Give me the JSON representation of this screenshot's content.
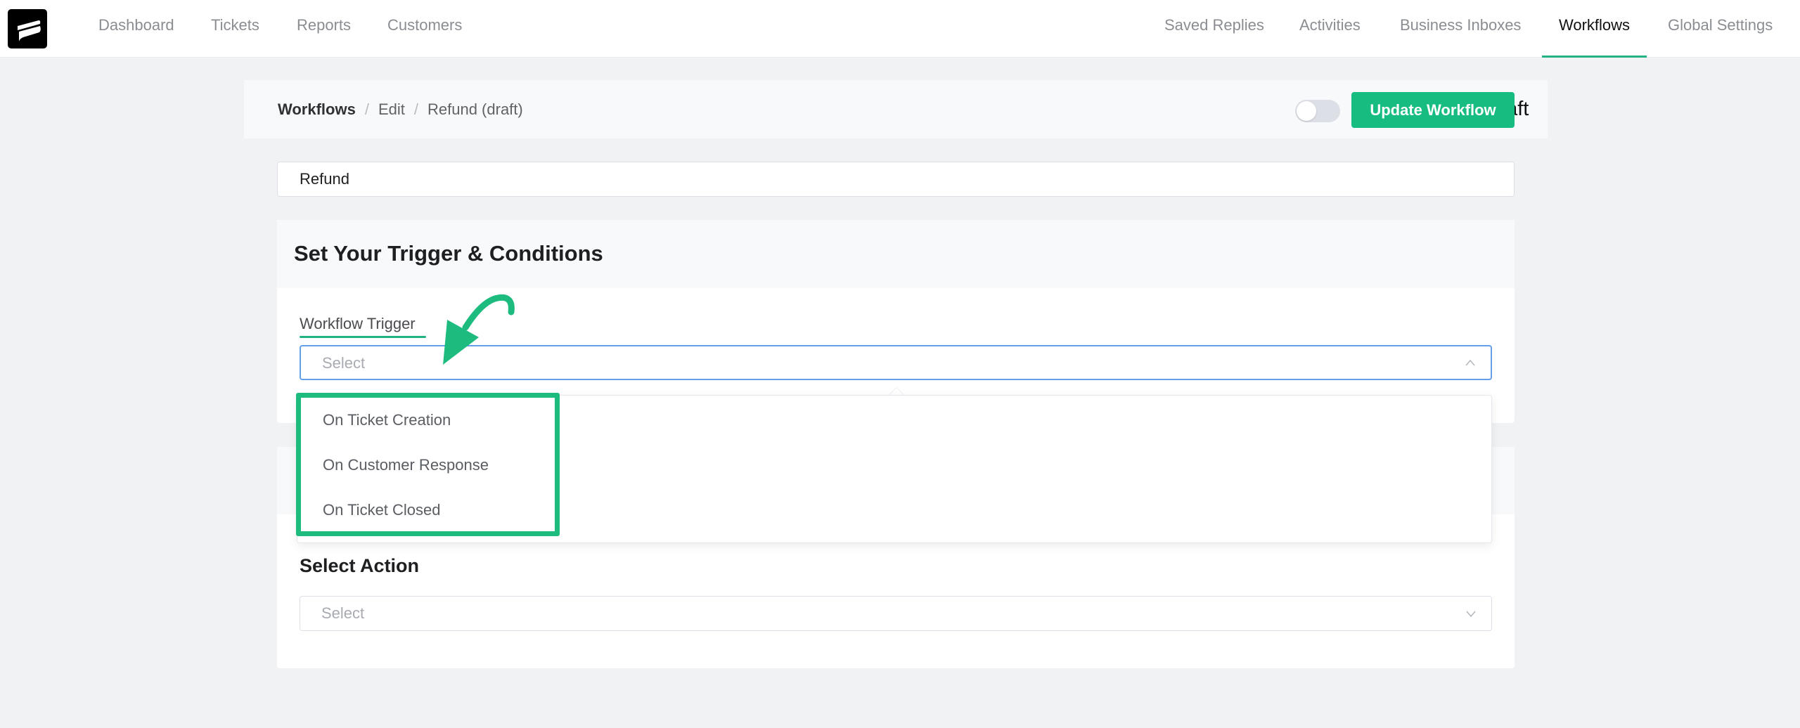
{
  "nav": {
    "left_items": [
      {
        "label": "Dashboard"
      },
      {
        "label": "Tickets"
      },
      {
        "label": "Reports"
      },
      {
        "label": "Customers"
      }
    ],
    "right_items": [
      {
        "label": "Saved Replies"
      },
      {
        "label": "Activities"
      },
      {
        "label": "Business Inboxes"
      },
      {
        "label": "Workflows",
        "active": true
      },
      {
        "label": "Global Settings"
      }
    ],
    "logo_icon": "fluent-support-logo"
  },
  "breadcrumb": {
    "items": [
      "Workflows",
      "Edit",
      "Refund (draft)"
    ],
    "separator": "/"
  },
  "status": {
    "label": "Status: draft",
    "enabled": false
  },
  "toolbar": {
    "update_label": "Update Workflow"
  },
  "workflow_name": {
    "value": "Refund"
  },
  "trigger_card": {
    "title": "Set Your Trigger & Conditions",
    "field_label": "Workflow Trigger",
    "select_placeholder": "Select",
    "dropdown_open": true,
    "options": [
      "On Ticket Creation",
      "On Customer Response",
      "On Ticket Closed"
    ]
  },
  "action_card": {
    "subheading": "Select Action",
    "select_placeholder": "Select"
  },
  "colors": {
    "accent": "#17bc81",
    "annotation": "#1dbb7e",
    "focus_border": "#64a0e8",
    "page_bg": "#f0f2f4"
  }
}
